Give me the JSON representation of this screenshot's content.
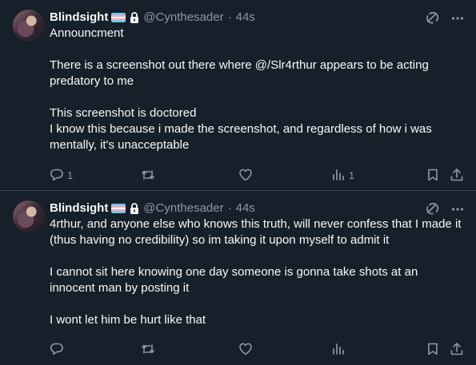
{
  "tweets": [
    {
      "author": {
        "name": "Blindsight",
        "handle": "@Cynthesader",
        "time": "44s"
      },
      "text": "Announcment\n\nThere is a screenshot out there where @/Slr4rthur appears to be acting predatory to me\n\nThis screenshot is doctored\nI know this because i made the screenshot, and regardless of how i was mentally, it's unacceptable",
      "stats": {
        "replies": "1",
        "retweets": "",
        "likes": "",
        "views": "1"
      }
    },
    {
      "author": {
        "name": "Blindsight",
        "handle": "@Cynthesader",
        "time": "44s"
      },
      "text": "4rthur, and anyone else who knows this truth, will never confess that I made it (thus having no credibility) so im taking it upon myself to admit it\n\nI cannot sit here knowing one day someone is gonna take shots at an innocent man by posting it\n\nI wont let him be hurt like that",
      "stats": {
        "replies": "",
        "retweets": "",
        "likes": "",
        "views": ""
      }
    }
  ],
  "icons": {
    "flag": "transgender-flag-icon",
    "lock": "lock-icon",
    "grok": "grok-icon",
    "more": "more-icon",
    "reply": "reply-icon",
    "retweet": "retweet-icon",
    "like": "heart-icon",
    "views": "views-icon",
    "bookmark": "bookmark-icon",
    "share": "share-icon"
  },
  "colors": {
    "background": "#15202b",
    "text": "#f7f9f9",
    "secondary": "#8b98a5",
    "divider": "#38444d"
  }
}
